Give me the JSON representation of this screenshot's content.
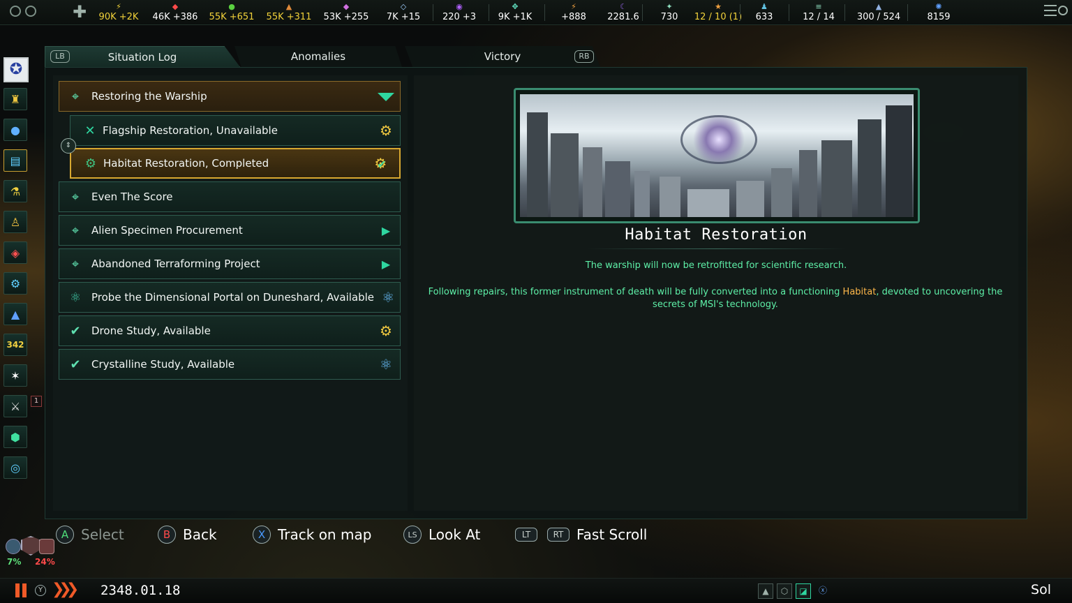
{
  "topbar": {
    "resources": [
      {
        "icon": "energy-icon",
        "glyph": "⚡",
        "value": "90K +2K",
        "color": "#f2d23a"
      },
      {
        "icon": "minerals-icon",
        "glyph": "◆",
        "value": "46K +386",
        "color": "#ffffff",
        "iconColor": "#ff4a4a"
      },
      {
        "icon": "food-icon",
        "glyph": "●",
        "value": "55K +651",
        "color": "#f2d23a",
        "iconColor": "#5ad040"
      },
      {
        "icon": "consumer-goods-icon",
        "glyph": "▲",
        "value": "55K +311",
        "color": "#f2d23a",
        "iconColor": "#e08a3a"
      },
      {
        "icon": "alloys-icon",
        "glyph": "◆",
        "value": "53K +255",
        "color": "#ffffff",
        "iconColor": "#d070e0"
      },
      {
        "icon": "influence-icon",
        "glyph": "◇",
        "value": "7K +15",
        "color": "#ffffff",
        "iconColor": "#a0d0ff"
      },
      {
        "icon": "unity-icon",
        "glyph": "◉",
        "value": "220 +3",
        "color": "#ffffff",
        "iconColor": "#b060ff"
      },
      {
        "icon": "research-icon",
        "glyph": "✥",
        "value": "9K +1K",
        "color": "#ffffff",
        "iconColor": "#60e0c0"
      },
      {
        "icon": "physics-icon",
        "glyph": "⚡",
        "value": "+888",
        "color": "#ffffff",
        "iconColor": "#f0a040"
      },
      {
        "icon": "society-icon",
        "glyph": "☾",
        "value": "2281.6",
        "color": "#ffffff",
        "iconColor": "#9060e0"
      },
      {
        "icon": "engineering-icon",
        "glyph": "✦",
        "value": "730",
        "color": "#ffffff",
        "iconColor": "#90e0c0"
      },
      {
        "icon": "envoys-icon",
        "glyph": "★",
        "value": "12 / 10 (1)",
        "color": "#f2d23a",
        "iconColor": "#f0a040"
      },
      {
        "icon": "pops-icon",
        "glyph": "♟",
        "value": "633",
        "color": "#ffffff",
        "iconColor": "#60c0e0"
      },
      {
        "icon": "starbases-icon",
        "glyph": "≡",
        "value": "12 / 14",
        "color": "#ffffff",
        "iconColor": "#90e0c0"
      },
      {
        "icon": "fleet-icon",
        "glyph": "▲",
        "value": "300 / 524",
        "color": "#ffffff",
        "iconColor": "#90b0e0"
      },
      {
        "icon": "stability-icon",
        "glyph": "✺",
        "value": "8159",
        "color": "#ffffff",
        "iconColor": "#60a0ff"
      }
    ]
  },
  "tabs": {
    "lb": "LB",
    "rb": "RB",
    "situation_log": "Situation Log",
    "anomalies": "Anomalies",
    "victory": "Victory"
  },
  "list": [
    {
      "label": "Restoring the Warship",
      "icon": "location-pin-icon",
      "right": "collapse-triangle-icon",
      "type": "head"
    },
    {
      "label": "Flagship Restoration, Unavailable",
      "icon": "crossed-swords-icon",
      "right": "gear-icon",
      "type": "sub"
    },
    {
      "label": "Habitat Restoration, Completed",
      "icon": "gear-cluster-icon",
      "right": "gear-check-icon",
      "type": "sub-selected"
    },
    {
      "label": "Even The Score",
      "icon": "location-pin-icon",
      "right": "",
      "type": "normal"
    },
    {
      "label": "Alien Specimen Procurement",
      "icon": "location-pin-icon",
      "right": "arrow-right-icon",
      "type": "normal"
    },
    {
      "label": "Abandoned Terraforming Project",
      "icon": "location-pin-icon",
      "right": "arrow-right-icon",
      "type": "normal"
    },
    {
      "label": "Probe the Dimensional Portal on Duneshard, Available",
      "icon": "atom-icon",
      "right": "atom-icon",
      "type": "normal"
    },
    {
      "label": "Drone Study, Available",
      "icon": "check-icon",
      "right": "gear-icon",
      "type": "normal"
    },
    {
      "label": "Crystalline Study, Available",
      "icon": "check-icon",
      "right": "atom-icon",
      "type": "normal"
    }
  ],
  "detail": {
    "title": "Habitat Restoration",
    "subtitle": "The warship will now be retrofitted for scientific research.",
    "desc_pre": "Following repairs, this former instrument of death will be fully converted into a functioning ",
    "desc_hl": "Habitat",
    "desc_post": ", devoted to uncovering the secrets of MSI's technology."
  },
  "prompts": [
    {
      "key": "A",
      "label": "Select",
      "keyColor": "#4fe07a",
      "dim": true
    },
    {
      "key": "B",
      "label": "Back",
      "keyColor": "#ff4a4a",
      "dim": false
    },
    {
      "key": "X",
      "label": "Track on map",
      "keyColor": "#4a9aff",
      "dim": false
    },
    {
      "key": "LS",
      "label": "Look At",
      "keyColor": "#c8d0cc",
      "dim": false
    },
    {
      "key": "LT",
      "label": "",
      "keyColor": "#c8d0cc",
      "dim": false
    },
    {
      "key": "RT",
      "label": "Fast Scroll",
      "keyColor": "#c8d0cc",
      "dim": false
    }
  ],
  "side_badge": "1",
  "side_counter": "342",
  "bottom": {
    "date": "2348.01.18",
    "location": "Sol",
    "y_key": "Y",
    "left_pct": "7%",
    "right_pct": "24%"
  }
}
